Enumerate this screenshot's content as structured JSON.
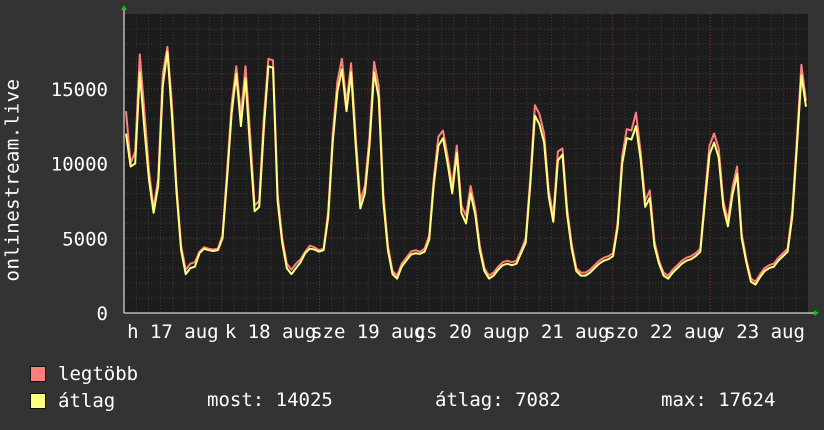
{
  "chart_data": {
    "type": "line",
    "ylabel": "onlinestream.live",
    "ylim": [
      0,
      20000
    ],
    "yticks": [
      0,
      5000,
      10000,
      15000
    ],
    "day_labels": [
      "h 17 aug",
      "k 18 aug",
      "sze 19 aug",
      "cs 20 aug",
      "p 21 aug",
      "szo 22 aug",
      "v 23 aug"
    ],
    "grid": true,
    "background": "#1c1c1c",
    "series": [
      {
        "name": "legtöbb",
        "color": "#ff7f7f",
        "values": [
          13500,
          10000,
          10800,
          17300,
          13500,
          9500,
          7000,
          9000,
          16000,
          17800,
          14000,
          8500,
          4500,
          2900,
          3300,
          3400,
          4100,
          4400,
          4300,
          4250,
          4300,
          5200,
          9500,
          14000,
          16500,
          13200,
          16500,
          12000,
          7200,
          7500,
          13000,
          17000,
          16900,
          8000,
          5000,
          3300,
          2900,
          3300,
          3600,
          4100,
          4500,
          4400,
          4200,
          4300,
          6800,
          12000,
          15500,
          17000,
          14000,
          16700,
          11800,
          7500,
          8500,
          11800,
          16800,
          15200,
          8000,
          4500,
          2800,
          2500,
          3300,
          3700,
          4100,
          4200,
          4100,
          4300,
          5200,
          9000,
          11800,
          12200,
          10500,
          8500,
          11200,
          7200,
          6500,
          8500,
          7000,
          4500,
          3000,
          2500,
          2700,
          3100,
          3400,
          3500,
          3400,
          3500,
          4200,
          5000,
          9000,
          13900,
          13300,
          12000,
          8200,
          6500,
          10800,
          11000,
          7000,
          4600,
          3000,
          2700,
          2700,
          2900,
          3200,
          3500,
          3700,
          3800,
          4000,
          6000,
          10500,
          12300,
          12200,
          13400,
          10800,
          7500,
          8200,
          4800,
          3500,
          2700,
          2500,
          2900,
          3200,
          3500,
          3700,
          3800,
          4000,
          4300,
          7800,
          11200,
          12000,
          11000,
          7500,
          6200,
          8400,
          9800,
          5300,
          3600,
          2300,
          2100,
          2600,
          3000,
          3200,
          3300,
          3700,
          4000,
          4300,
          6800,
          11500,
          16600,
          14200
        ]
      },
      {
        "name": "átlag",
        "color": "#ffff80",
        "values": [
          12000,
          9800,
          10000,
          16100,
          12300,
          8900,
          6700,
          8500,
          15200,
          17500,
          13200,
          8100,
          4200,
          2600,
          3000,
          3100,
          4000,
          4300,
          4200,
          4150,
          4200,
          5000,
          9000,
          13400,
          16000,
          12500,
          15700,
          11000,
          6800,
          7100,
          12300,
          16500,
          16400,
          7500,
          4700,
          3000,
          2600,
          3000,
          3400,
          4000,
          4300,
          4250,
          4100,
          4200,
          6400,
          11500,
          14800,
          16300,
          13500,
          16100,
          11200,
          7000,
          8000,
          11200,
          16100,
          14400,
          7500,
          4200,
          2600,
          2300,
          3100,
          3500,
          3900,
          4000,
          3950,
          4100,
          4900,
          8600,
          11200,
          11700,
          10000,
          8000,
          10700,
          6700,
          6000,
          8000,
          6600,
          4200,
          2800,
          2300,
          2500,
          2900,
          3200,
          3300,
          3200,
          3300,
          4000,
          4700,
          8600,
          13200,
          12600,
          11400,
          7800,
          6100,
          10200,
          10600,
          6600,
          4300,
          2800,
          2500,
          2500,
          2700,
          3000,
          3300,
          3500,
          3600,
          3800,
          5700,
          10000,
          11700,
          11600,
          12500,
          10300,
          7100,
          7700,
          4500,
          3300,
          2500,
          2300,
          2700,
          3000,
          3300,
          3500,
          3600,
          3800,
          4100,
          7400,
          10600,
          11400,
          10400,
          7100,
          5800,
          7900,
          9300,
          5000,
          3400,
          2100,
          1900,
          2400,
          2800,
          3000,
          3100,
          3500,
          3800,
          4100,
          6400,
          11000,
          15900,
          13800
        ]
      }
    ],
    "legend_placement": "bottom-left"
  },
  "stats": {
    "most_label": "most:",
    "most_value": "14025",
    "atlag_label": "átlag:",
    "atlag_value": "7082",
    "max_label": "max:",
    "max_value": "17624"
  }
}
